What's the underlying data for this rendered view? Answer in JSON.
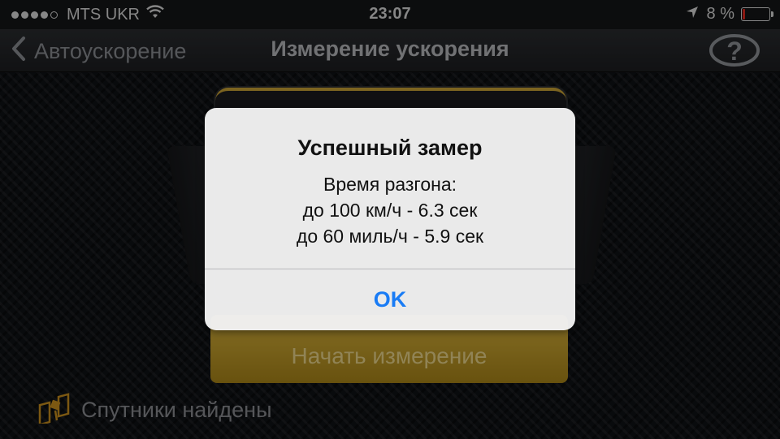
{
  "status_bar": {
    "carrier": "MTS UKR",
    "time": "23:07",
    "battery_percent": "8 %",
    "battery_level": 0.08,
    "signal_bars_filled": 4,
    "signal_bars_total": 5,
    "icons": [
      "signal-dots-icon",
      "wifi-icon",
      "location-arrow-icon",
      "battery-icon"
    ]
  },
  "nav": {
    "back_label": "Автоускорение",
    "title": "Измерение ускорения",
    "help_icon": "question-mark-icon"
  },
  "main": {
    "start_button_label": "Начать измерение",
    "satellite_status": "Спутники найдены",
    "satellite_icon": "satellite-icon"
  },
  "alert": {
    "title": "Успешный замер",
    "message_lines": [
      "Время разгона:",
      "до 100 км/ч - 6.3 сек",
      "до 60 миль/ч - 5.9 сек"
    ],
    "ok_label": "OK"
  },
  "colors": {
    "accent_gold": "#c9a235",
    "ok_blue": "#1a7cf5",
    "battery_low": "#e0281e"
  }
}
